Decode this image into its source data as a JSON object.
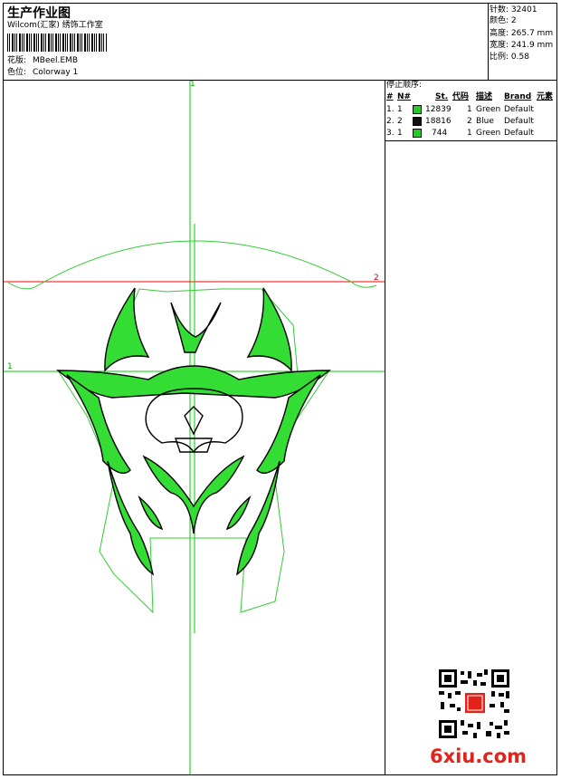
{
  "header": {
    "title": "生产作业图",
    "company": "Wilcom(汇家) 绣饰工作室",
    "design_label": "花版:",
    "design_value": "MBeel.EMB",
    "colorway_label": "色位:",
    "colorway_value": "Colorway 1"
  },
  "stats": [
    {
      "label": "针数:",
      "value": "32401"
    },
    {
      "label": "颜色:",
      "value": "2"
    },
    {
      "label": "高度:",
      "value": "265.7 mm"
    },
    {
      "label": "宽度:",
      "value": "241.9 mm"
    },
    {
      "label": "比例:",
      "value": "0.58"
    }
  ],
  "legend": {
    "title": "停止顺序:",
    "columns": [
      "#",
      "N#",
      "St.",
      "代码",
      "描述",
      "Brand",
      "元素"
    ],
    "rows": [
      {
        "idx": "1.",
        "n": "1",
        "color": "#22cc22",
        "st": "12839",
        "code": "1",
        "desc": "Green",
        "brand": "Default"
      },
      {
        "idx": "2.",
        "n": "2",
        "color": "#111111",
        "st": "18816",
        "code": "2",
        "desc": "Blue",
        "brand": "Default"
      },
      {
        "idx": "3.",
        "n": "1",
        "color": "#22cc22",
        "st": "744",
        "code": "1",
        "desc": "Green",
        "brand": "Default"
      }
    ]
  },
  "canvas": {
    "marker_top": "1",
    "marker_left": "1",
    "marker_right": "2",
    "guide_color": "#00cc00",
    "hoop_color": "#ff0000"
  },
  "watermark": {
    "text": "6xiu.com"
  }
}
